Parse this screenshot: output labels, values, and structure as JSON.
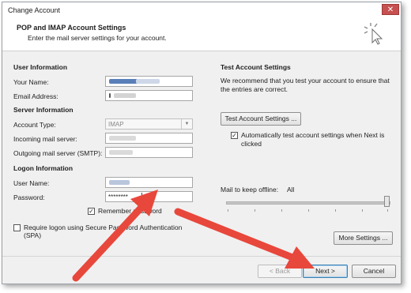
{
  "window": {
    "title": "Change Account",
    "close_glyph": "✕"
  },
  "header": {
    "title": "POP and IMAP Account Settings",
    "subtitle": "Enter the mail server settings for your account."
  },
  "user_info": {
    "section": "User Information",
    "name_label": "Your Name:",
    "email_label": "Email Address:"
  },
  "server_info": {
    "section": "Server Information",
    "account_type_label": "Account Type:",
    "account_type_value": "IMAP",
    "incoming_label": "Incoming mail server:",
    "outgoing_label": "Outgoing mail server (SMTP):"
  },
  "logon_info": {
    "section": "Logon Information",
    "username_label": "User Name:",
    "password_label": "Password:",
    "password_value": "********",
    "remember_label": "Remember password",
    "remember_checked": true,
    "spa_label": "Require logon using Secure Password Authentication (SPA)",
    "spa_checked": false
  },
  "test": {
    "section": "Test Account Settings",
    "description": "We recommend that you test your account to ensure that the entries are correct.",
    "test_button": "Test Account Settings ...",
    "auto_test_label": "Automatically test account settings when Next is clicked",
    "auto_test_checked": true
  },
  "offline": {
    "label": "Mail to keep offline:",
    "value": "All",
    "level_fraction": 1.0
  },
  "buttons": {
    "more_settings": "More Settings ...",
    "back": "< Back",
    "next": "Next >",
    "cancel": "Cancel"
  },
  "colors": {
    "arrow": "#e8473c",
    "blurred_text": "#5a7fb8"
  }
}
